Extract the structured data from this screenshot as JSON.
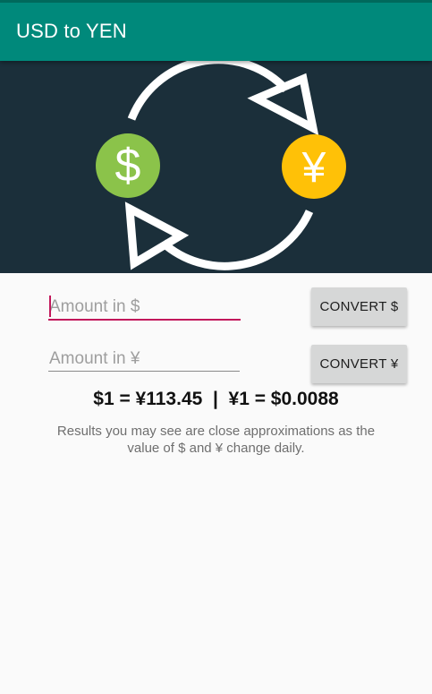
{
  "app": {
    "title": "USD to YEN"
  },
  "hero": {
    "dollar_symbol": "$",
    "yen_symbol": "¥",
    "dollar_color": "#8bc34a",
    "yen_color": "#ffc107",
    "background": "#1b2f3a"
  },
  "usd_input": {
    "placeholder": "Amount in $",
    "value": ""
  },
  "yen_input": {
    "placeholder": "Amount in ¥",
    "value": ""
  },
  "buttons": {
    "convert_usd": "CONVERT $",
    "convert_yen": "CONVERT ¥"
  },
  "rates_text": "$1 = ¥113.45  |  ¥1 = $0.0088",
  "disclaimer": "Results you may see are close approximations as the value of $ and ¥ change daily.",
  "colors": {
    "primary": "#00897b",
    "accent": "#c2185b"
  }
}
